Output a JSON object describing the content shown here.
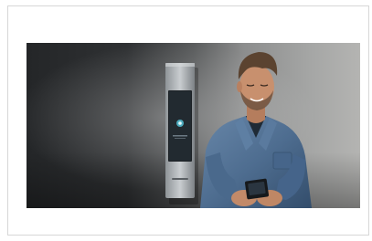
{
  "image": {
    "subject": "man-with-smartphone-beside-door-intercom",
    "screen_icon": "key-icon",
    "colors": {
      "wall_dark": "#2b2d2f",
      "wall_light": "#9a9b9b",
      "panel_silver": "#a9adb0",
      "panel_screen": "#1e2327",
      "shirt_denim": "#4f6f92",
      "skin": "#c8906e",
      "hair": "#5b4330"
    }
  }
}
